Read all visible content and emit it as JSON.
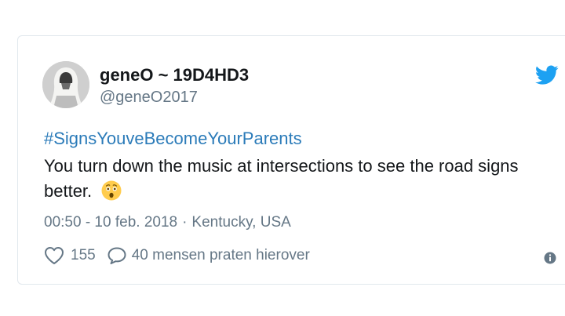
{
  "tweet": {
    "author_name": "geneO ~ 19D4HD3",
    "author_handle": "@geneO2017",
    "hashtag": "#SignsYouveBecomeYourParents",
    "text": "You turn down the music at intersections to see the road signs better.",
    "emoji": "astonished-face-emoji",
    "time": "00:50 - 10 feb. 2018",
    "separator": "·",
    "location": "Kentucky, USA",
    "likes": "155",
    "replies_label": "40 mensen praten hierover"
  },
  "colors": {
    "twitter_blue": "#1da1f2",
    "hashtag_blue": "#2b7bb9",
    "text": "#14171a",
    "muted": "#657786",
    "border": "#e1e8ed"
  },
  "icons": {
    "brand": "twitter-bird-icon",
    "like": "heart-icon",
    "reply": "speech-bubble-icon",
    "info": "info-icon"
  }
}
